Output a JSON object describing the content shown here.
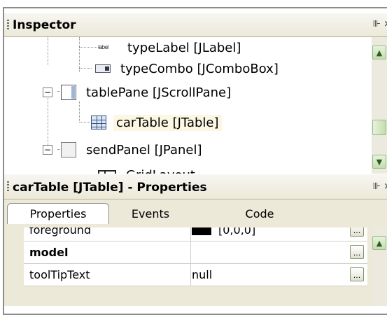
{
  "inspector": {
    "title": "Inspector",
    "controls": "⊪ ×",
    "tree": [
      {
        "label": "typeLabel [JLabel]",
        "icon": "label-icon",
        "icon_text": "label"
      },
      {
        "label": "typeCombo [JComboBox]",
        "icon": "combobox-icon"
      },
      {
        "label": "tablePane [JScrollPane]",
        "icon": "scrollpane-icon",
        "expander": "−"
      },
      {
        "label": "carTable [JTable]",
        "icon": "table-icon",
        "selected": true
      },
      {
        "label": "sendPanel [JPanel]",
        "icon": "panel-icon",
        "expander": "−"
      },
      {
        "label": "GridLayout",
        "icon": "gridlayout-icon"
      }
    ]
  },
  "properties": {
    "title": "carTable [JTable] - Properties",
    "controls": "⊪ ×",
    "tabs": [
      {
        "label": "Properties",
        "active": true
      },
      {
        "label": "Events"
      },
      {
        "label": "Code"
      }
    ],
    "rows": [
      {
        "name": "foreground",
        "value": "[0,0,0]",
        "swatch": "#000000"
      },
      {
        "name": "model",
        "value": "",
        "bold": true
      },
      {
        "name": "toolTipText",
        "value": "null"
      }
    ],
    "ellipsis": "..."
  },
  "colors": {
    "titlebar": "#ece9d8",
    "selection": "#fbf7e3",
    "scroll_green": "#c3ddb0"
  }
}
